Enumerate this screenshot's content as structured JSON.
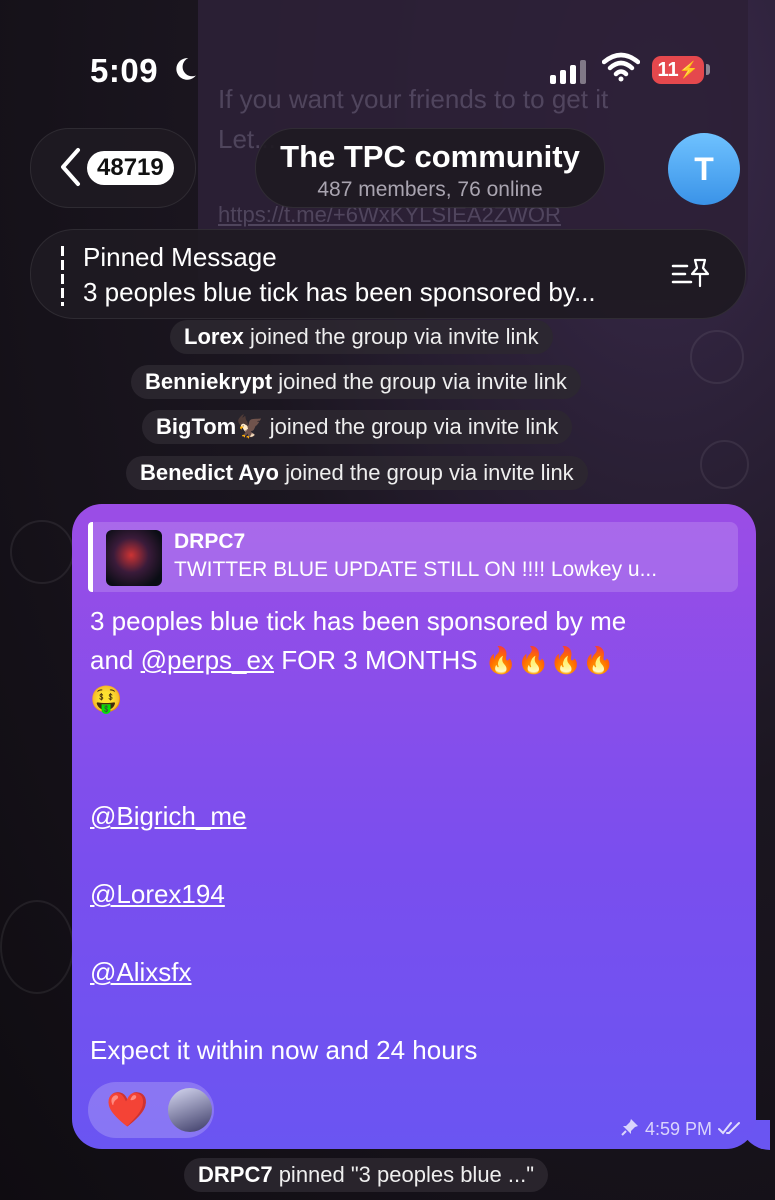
{
  "status_bar": {
    "time": "5:09",
    "battery": "11"
  },
  "background_text": {
    "line1": "If you want your friends to to get it",
    "line2": "Let...",
    "line3": "https://t.me/+6WxKYLSIEA2ZWOR"
  },
  "header": {
    "back_count": "48719",
    "title": "The TPC community",
    "subtitle": "487 members, 76 online",
    "avatar_letter": "T"
  },
  "pinned": {
    "label": "Pinned Message",
    "text": "3 peoples blue tick has been sponsored by..."
  },
  "service_messages": [
    {
      "name": "Lorex",
      "text": " joined the group via invite link"
    },
    {
      "name": "Benniekrypt",
      "text": " joined the group via invite link"
    },
    {
      "name": "BigTom🦅",
      "text": " joined the group via invite link"
    },
    {
      "name": "Benedict Ayo",
      "text": " joined the group via invite link"
    }
  ],
  "message": {
    "reply_name": "DRPC7",
    "reply_text": "TWITTER BLUE UPDATE STILL ON !!!! Lowkey u...",
    "line1": "3 peoples blue tick has been sponsored by me",
    "line2_prefix": "and ",
    "line2_mention": "@perps_ex",
    "line2_suffix": " FOR 3 MONTHS 🔥🔥🔥🔥",
    "line3": "🤑",
    "mentions": [
      "@Bigrich_me",
      "@Lorex194",
      "@Alixsfx"
    ],
    "closing": "Expect it within now and 24 hours",
    "time": "4:59 PM",
    "reaction": "❤️"
  },
  "pinned_notice": {
    "name": "DRPC7",
    "text": " pinned \"3 peoples blue ...\""
  }
}
